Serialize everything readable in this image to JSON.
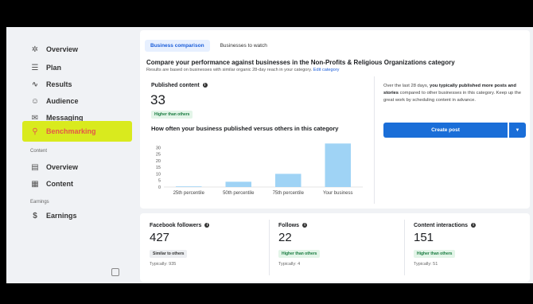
{
  "sidebar": {
    "items": [
      {
        "label": "Overview",
        "icon": "overview-icon"
      },
      {
        "label": "Plan",
        "icon": "plan-icon"
      },
      {
        "label": "Results",
        "icon": "results-icon"
      },
      {
        "label": "Audience",
        "icon": "audience-icon"
      },
      {
        "label": "Messaging",
        "icon": "messaging-icon"
      },
      {
        "label": "Benchmarking",
        "icon": "benchmarking-icon"
      }
    ],
    "content_section": "Content",
    "content_items": [
      {
        "label": "Overview",
        "icon": "content-overview-icon"
      },
      {
        "label": "Content",
        "icon": "content-icon"
      }
    ],
    "earnings_section": "Earnings",
    "earnings_items": [
      {
        "label": "Earnings",
        "icon": "dollar-icon"
      }
    ]
  },
  "tabs": [
    "Business comparison",
    "Businesses to watch"
  ],
  "headline": "Compare your performance against businesses in the Non-Profits & Religious Organizations category",
  "subline": "Results are based on businesses with similar organic 28-day reach in your category.",
  "edit_category": "Edit category",
  "published": {
    "label": "Published content",
    "value": "33",
    "badge": "Higher than others"
  },
  "chart_title": "How often your business published versus others in this category",
  "chart_data": {
    "type": "bar",
    "categories": [
      "25th percentile",
      "50th percentile",
      "75th percentile",
      "Your business"
    ],
    "values": [
      0,
      4,
      10,
      33
    ],
    "ylim": [
      0,
      35
    ],
    "yticks": [
      0,
      5,
      10,
      15,
      20,
      25,
      30
    ],
    "bar_color": "#9fd3f5"
  },
  "advice": {
    "prefix": "Over the last 28 days, ",
    "bold": "you typically published more posts and stories",
    "suffix": " compared to other businesses in this category. Keep up the great work by scheduling content in advance."
  },
  "create_post": "Create post",
  "metrics": [
    {
      "label": "Facebook followers",
      "value": "427",
      "badge": "Similar to others",
      "badge_color": "gray",
      "typical": "Typically: 935"
    },
    {
      "label": "Follows",
      "value": "22",
      "badge": "Higher than others",
      "badge_color": "green",
      "typical": "Typically: 4"
    },
    {
      "label": "Content interactions",
      "value": "151",
      "badge": "Higher than others",
      "badge_color": "green",
      "typical": "Typically: 51"
    }
  ],
  "colors": {
    "accent": "#1a6ed8",
    "highlight": "#d9ea1e",
    "highlight_text": "#e4574a"
  }
}
